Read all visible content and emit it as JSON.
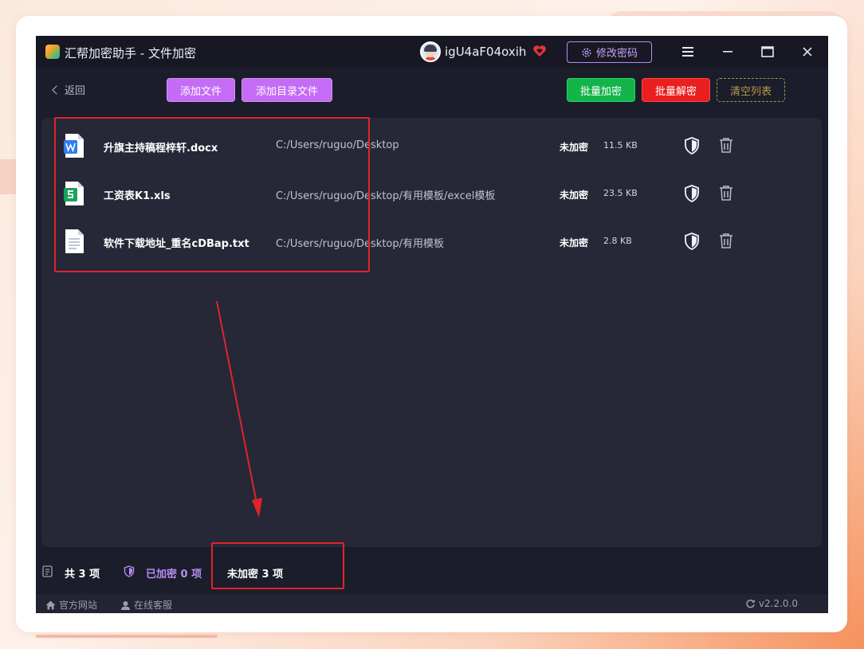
{
  "window": {
    "title": "汇帮加密助手 - 文件加密",
    "username": "igU4aF04oxih",
    "change_password_label": "修改密码"
  },
  "toolbar": {
    "back_label": "返回",
    "add_file_label": "添加文件",
    "add_folder_label": "添加目录文件",
    "batch_encrypt_label": "批量加密",
    "batch_decrypt_label": "批量解密",
    "clear_list_label": "清空列表"
  },
  "files": [
    {
      "name": "升旗主持稿程梓轩.docx",
      "path": "C:/Users/ruguo/Desktop",
      "status": "未加密",
      "size": "11.5 KB",
      "icon": "word-doc-icon"
    },
    {
      "name": "工资表K1.xls",
      "path": "C:/Users/ruguo/Desktop/有用模板/excel模板",
      "status": "未加密",
      "size": "23.5 KB",
      "icon": "spreadsheet-icon"
    },
    {
      "name": "软件下载地址_重名cDBap.txt",
      "path": "C:/Users/ruguo/Desktop/有用模板",
      "status": "未加密",
      "size": "2.8 KB",
      "icon": "text-file-icon"
    }
  ],
  "summary": {
    "total_label": "共 3 项",
    "encrypted_label": "已加密 0 项",
    "unencrypted_label": "未加密 3 项"
  },
  "footer": {
    "website_label": "官方网站",
    "support_label": "在线客服",
    "version": "v2.2.0.0"
  },
  "colors": {
    "accent_purple": "#c46cf5",
    "encrypt_green": "#13b54a",
    "decrypt_red": "#ea1f1f",
    "annotation_red": "#e0242a"
  }
}
